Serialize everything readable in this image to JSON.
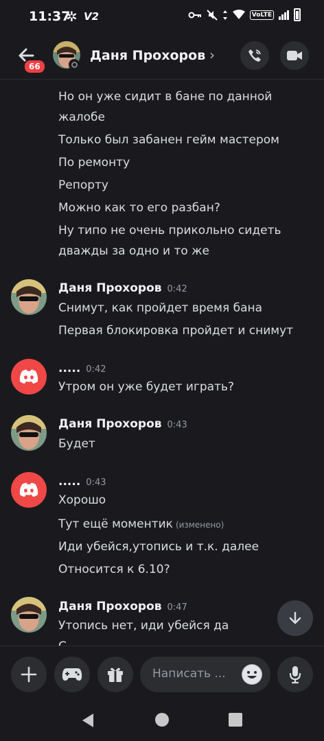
{
  "status_bar": {
    "time": "11:37",
    "v2": "V2",
    "volte": "VoLTE"
  },
  "header": {
    "title": "Даня Прохоров",
    "back_badge": "66"
  },
  "messages": {
    "cont": [
      "Но он уже сидит в бане по данной",
      "жалобе",
      "Только был забанен гейм мастером",
      "По ремонту",
      "Репорту",
      "Можно как то его разбан?",
      "Ну типо не очень прикольно сидеть",
      "дважды за одно и то же"
    ],
    "groups": [
      {
        "author": "Даня Прохоров",
        "time": "0:42",
        "lines": [
          "Снимут, как пройдет время бана",
          "Первая блокировка пройдет и снимут"
        ]
      },
      {
        "author": ".....",
        "time": "0:42",
        "lines": [
          "Утром он уже будет играть?"
        ]
      },
      {
        "author": "Даня Прохоров",
        "time": "0:43",
        "lines": [
          "Будет"
        ]
      },
      {
        "author": ".....",
        "time": "0:43",
        "lines": [
          "Хорошо",
          "Тут ещё моментик",
          "Иди убейся,утопись и т.к. далее",
          "Относится к 6.10?"
        ],
        "edited": "(изменено)"
      },
      {
        "author": "Даня Прохоров",
        "time": "0:47",
        "lines": [
          "Утопись нет, иди убейся да",
          "С"
        ]
      }
    ]
  },
  "input": {
    "placeholder": "Написать ..."
  },
  "colors": {
    "accent": "#f04747",
    "background": "#1a1a1e",
    "surface": "#2b2d31",
    "badge": "#f23f43"
  },
  "icons": [
    "back-arrow-icon",
    "phone-call-icon",
    "video-camera-icon",
    "discord-logo-icon",
    "plus-icon",
    "gamepad-icon",
    "gift-icon",
    "emoji-icon",
    "microphone-icon",
    "arrow-down-icon",
    "nav-back-icon",
    "nav-home-icon",
    "nav-recents-icon"
  ]
}
